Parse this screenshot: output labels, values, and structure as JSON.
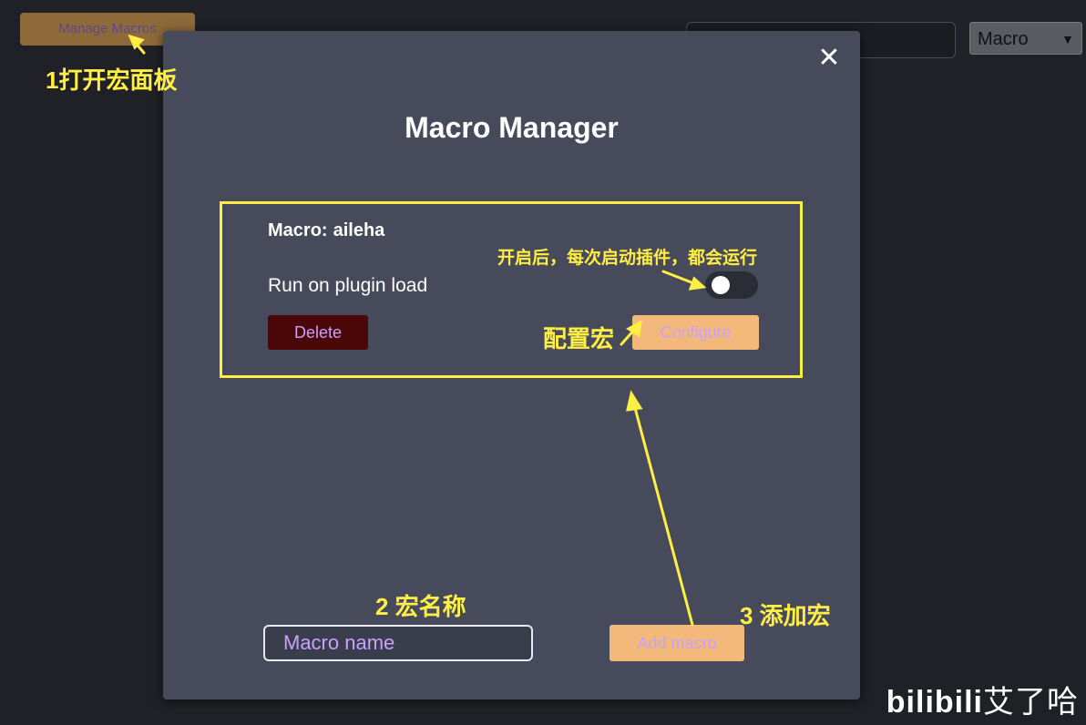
{
  "background": {
    "manage_button": "Manage Macros",
    "select_value": "Macro"
  },
  "modal": {
    "title": "Macro Manager",
    "close_symbol": "✕",
    "macro": {
      "name_prefix": "Macro:",
      "name": "aileha",
      "run_on_load_label": "Run on plugin load",
      "run_on_load": false,
      "delete_label": "Delete",
      "configure_label": "Configure"
    },
    "new_macro_placeholder": "Macro name",
    "add_label": "Add macro"
  },
  "annotations": {
    "step1": "1打开宏面板",
    "toggle_note": "开启后，每次启动插件，都会运行",
    "configure_note": "配置宏",
    "step2": "2 宏名称",
    "step3": "3 添加宏"
  },
  "watermark": {
    "logo": "bilibili",
    "author": "艾了哈"
  },
  "colors": {
    "annotation": "#ffee44",
    "button_accent": "#f2b97a",
    "button_text": "#c9a0ff",
    "delete_bg": "#4a0708",
    "modal_bg": "#474a5a"
  }
}
